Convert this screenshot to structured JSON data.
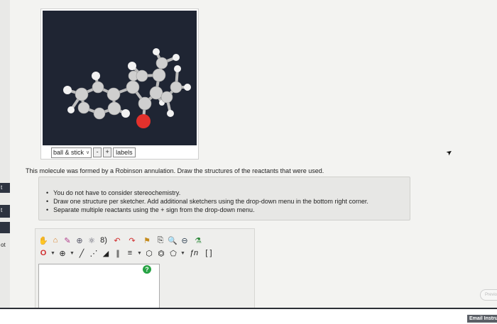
{
  "left_strip": {
    "letters": [
      "t",
      "t",
      "ot"
    ]
  },
  "viewer": {
    "display_mode": "ball & stick",
    "minus_label": "-",
    "plus_label": "+",
    "labels_label": "labels"
  },
  "question": {
    "text": "This molecule was formed by a Robinson annulation. Draw the structures of the reactants that were used."
  },
  "hints": [
    "You do not have to consider stereochemistry.",
    "Draw one structure per sketcher. Add additional sketchers using the drop-down menu in the bottom right corner.",
    "Separate multiple reactants using the + sign from the drop-down menu."
  ],
  "sketcher": {
    "row1": [
      "hand-icon",
      "eraser-icon",
      "pencil-icon",
      "zoom-fit-icon",
      "cleanup-icon",
      "ring-arrow-icon",
      "lasso-icon",
      "rotate-icon",
      "template-icon",
      "zoom-in-icon",
      "zoom-out-icon",
      "bond-drawer-icon"
    ],
    "bracket_label": "[ ]",
    "fn_label": "ƒn",
    "help_label": "?"
  },
  "footer": {
    "next_label": "Previo",
    "email_label": "Email Instru"
  },
  "colors": {
    "viewer_bg": "#1f2533",
    "carbon": "#d7d7d7",
    "oxygen": "#e3312c",
    "help_green": "#27a344"
  }
}
